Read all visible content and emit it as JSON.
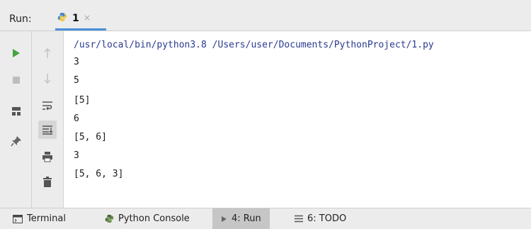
{
  "run_panel": {
    "title": "Run:",
    "tab": {
      "label": "1",
      "close": "×"
    }
  },
  "console": {
    "lines": [
      "/usr/local/bin/python3.8 /Users/user/Documents/PythonProject/1.py",
      "3",
      "5",
      "[5]",
      "6",
      "[5, 6]",
      "3",
      "[5, 6, 3]"
    ]
  },
  "bottom_bar": {
    "items": [
      {
        "label": "Terminal",
        "icon": "terminal-icon"
      },
      {
        "label": "Python Console",
        "icon": "python-console-icon"
      },
      {
        "label": "4: Run",
        "icon": "run-icon",
        "active": true
      },
      {
        "label": "6: TODO",
        "icon": "todo-icon"
      }
    ]
  },
  "colors": {
    "accent": "#4a8fd8",
    "run_green": "#48a23f",
    "command_text": "#2a3b8f"
  }
}
